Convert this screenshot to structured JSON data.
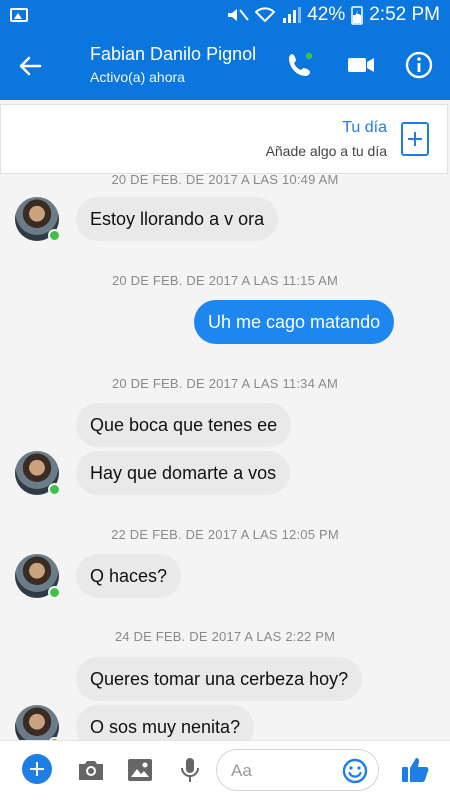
{
  "status_bar": {
    "battery": "42%",
    "time": "2:52 PM"
  },
  "header": {
    "contact_name": "Fabian Danilo Pignol",
    "presence": "Activo(a) ahora"
  },
  "your_day": {
    "title": "Tu día",
    "subtitle": "Añade algo a tu día"
  },
  "messages": [
    {
      "timestamp": "20 DE FEB. DE 2017 A LAS 10:49 AM",
      "text": "Estoy llorando a v ora",
      "from": "contact"
    },
    {
      "timestamp": "20 DE FEB. DE 2017 A LAS 11:15 AM",
      "text": "Uh me cago matando",
      "from": "me"
    },
    {
      "timestamp": "20 DE FEB. DE 2017 A LAS 11:34 AM",
      "text": "Que boca que tenes ee",
      "from": "contact"
    },
    {
      "timestamp": "",
      "text": "Hay que domarte a vos",
      "from": "contact"
    },
    {
      "timestamp": "22 DE FEB. DE 2017 A LAS 12:05 PM",
      "text": "Q haces?",
      "from": "contact"
    },
    {
      "timestamp": "24 DE FEB. DE 2017 A LAS 2:22 PM",
      "text": "Queres tomar una cerbeza hoy?",
      "from": "contact"
    },
    {
      "timestamp": "",
      "text": "O sos muy nenita?",
      "from": "contact"
    }
  ],
  "composer": {
    "placeholder": "Aa"
  },
  "colors": {
    "brand": "#0a76de",
    "outgoing_bubble": "#1d86ef",
    "incoming_bubble": "#e9e9e9",
    "online_dot": "#3fc14a"
  }
}
